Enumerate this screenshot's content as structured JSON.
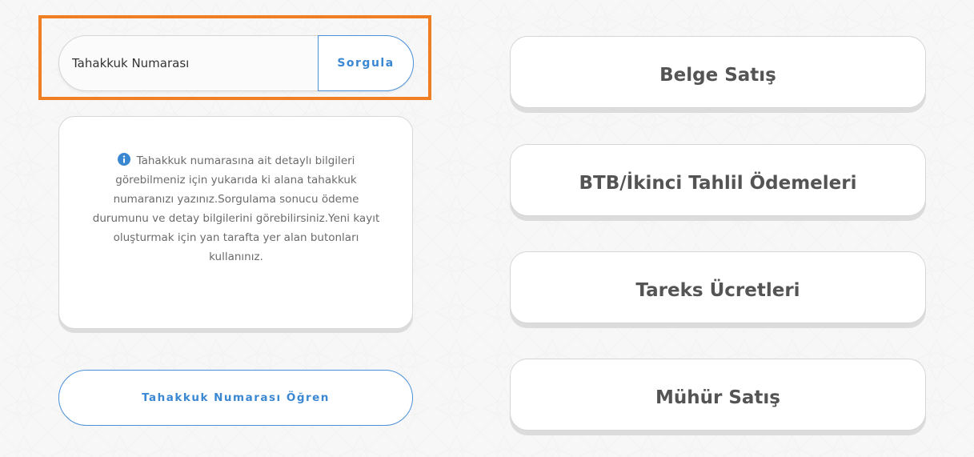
{
  "search": {
    "placeholder": "Tahakkuk Numarası",
    "value": "",
    "button_label": "Sorgula"
  },
  "info": {
    "text": "Tahakkuk numarasına ait detaylı bilgileri görebilmeniz için yukarıda ki alana tahakkuk numaranızı yazınız.Sorgulama sonucu ödeme durumunu ve detay bilgilerini görebilirsiniz.Yeni kayıt oluşturmak için yan tarafta yer alan butonları kullanınız.",
    "icon": "info-icon"
  },
  "learn_button": {
    "label": "Tahakkuk Numarası Öğren"
  },
  "actions": [
    {
      "label": "Belge Satış"
    },
    {
      "label": "BTB/İkinci Tahlil Ödemeleri"
    },
    {
      "label": "Tareks Ücretleri"
    },
    {
      "label": "Mühür Satış"
    }
  ],
  "colors": {
    "accent": "#3a87d2",
    "highlight": "#f07f23",
    "card_text": "#545454",
    "background": "#f7f7f7"
  }
}
